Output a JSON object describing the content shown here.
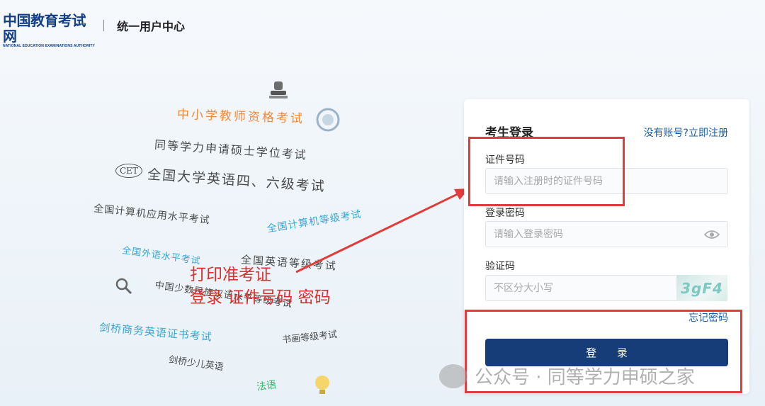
{
  "header": {
    "logo_cn": "中国教育考试网",
    "logo_en": "NATIONAL EDUCATION EXAMINATIONS AUTHORITY",
    "center_title": "统一用户中心"
  },
  "illustration": {
    "items": [
      "中小学教师资格考试",
      "同等学力申请硕士学位考试",
      "CET",
      "全国大学英语四、六级考试",
      "全国计算机应用水平考试",
      "全国计算机等级考试",
      "全国外语水平考试",
      "全国英语等级考试",
      "中国少数民族汉语水平等级考试",
      "剑桥商务英语证书考试",
      "书画等级考试",
      "剑桥少儿英语",
      "法语"
    ]
  },
  "login": {
    "title": "考生登录",
    "register_link": "没有账号?立即注册",
    "id_label": "证件号码",
    "id_placeholder": "请输入注册时的证件号码",
    "password_label": "登录密码",
    "password_placeholder": "请输入登录密码",
    "captcha_label": "验证码",
    "captcha_placeholder": "不区分大小写",
    "captcha_text": "3gF4",
    "forgot_link": "忘记密码",
    "submit_label": "登 录"
  },
  "annotation": {
    "line1": "打印准考证",
    "line2": "登录 证件号码 密码",
    "color": "#e23b3b"
  },
  "watermark": {
    "text": "公众号 · 同等学力申硕之家"
  }
}
